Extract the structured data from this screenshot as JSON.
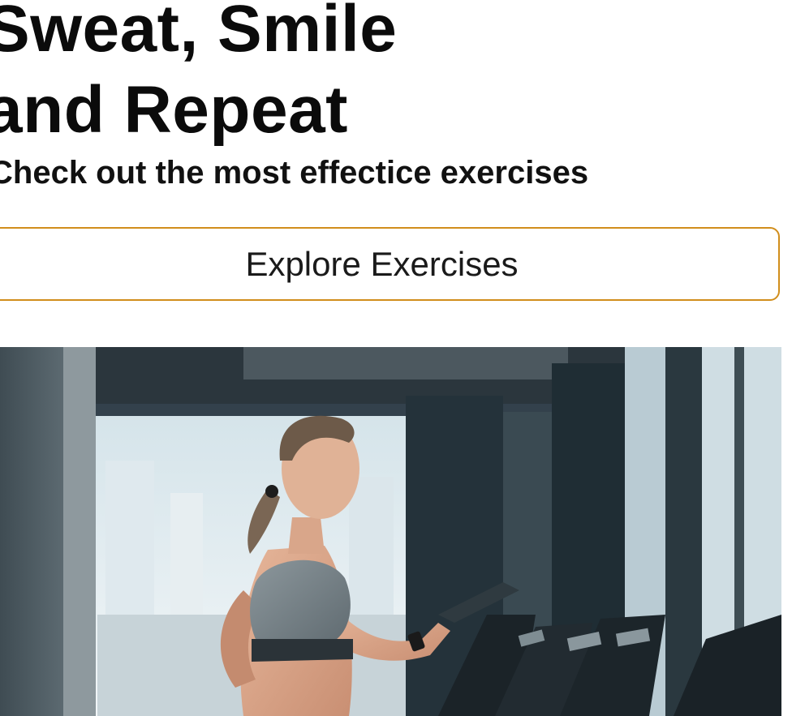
{
  "hero": {
    "title_line_1": "Sweat, Smile",
    "title_line_2": "and Repeat",
    "subtitle": "Check out the most effectice exercises",
    "cta_label": "Explore Exercises"
  },
  "image": {
    "subject": "woman-running-on-treadmill-photo"
  },
  "colors": {
    "accent": "#d18e1c",
    "heading_text": "#0b0b0b",
    "button_text": "#1a1a1a"
  }
}
